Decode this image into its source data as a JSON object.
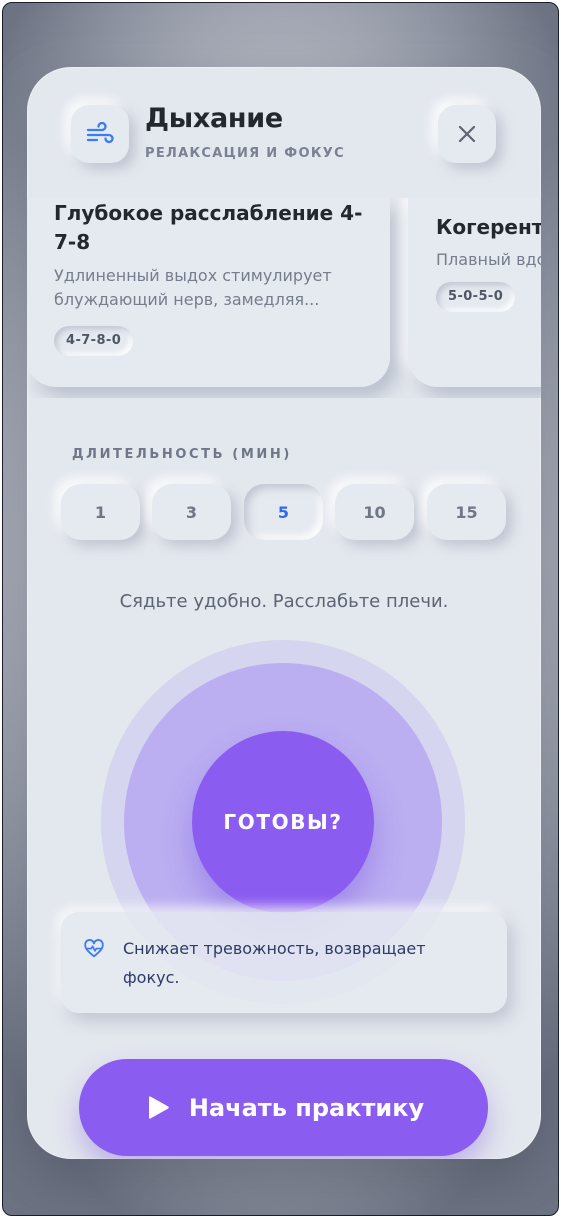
{
  "header": {
    "title": "Дыхание",
    "subtitle": "РЕЛАКСАЦИЯ И ФОКУС",
    "icon": "wind-icon",
    "close_icon": "close-icon"
  },
  "techniques": [
    {
      "title": "Глубокое расслабление 4-7-8",
      "description": "Удлиненный выдох стимулирует блуждающий нерв, замедляя...",
      "pattern": "4-7-8-0"
    },
    {
      "title": "Когерент",
      "description": "Плавный вдо задержек. Га",
      "pattern": "5-0-5-0"
    }
  ],
  "duration": {
    "label": "ДЛИТЕЛЬНОСТЬ (МИН)",
    "options": [
      "1",
      "3",
      "5",
      "10",
      "15"
    ],
    "selected": "5"
  },
  "instruction": "Сядьте удобно. Расслабьте плечи.",
  "breath": {
    "state": "ГОТОВЫ?"
  },
  "benefit": {
    "icon": "heart-pulse-icon",
    "text": "Снижает тревожность, возвращает фокус."
  },
  "start_button": {
    "label": "Начать практику",
    "icon": "play-icon"
  },
  "colors": {
    "accent": "#8b5cf0",
    "selected_text": "#2f6bea",
    "surface": "#e5e9f0"
  }
}
